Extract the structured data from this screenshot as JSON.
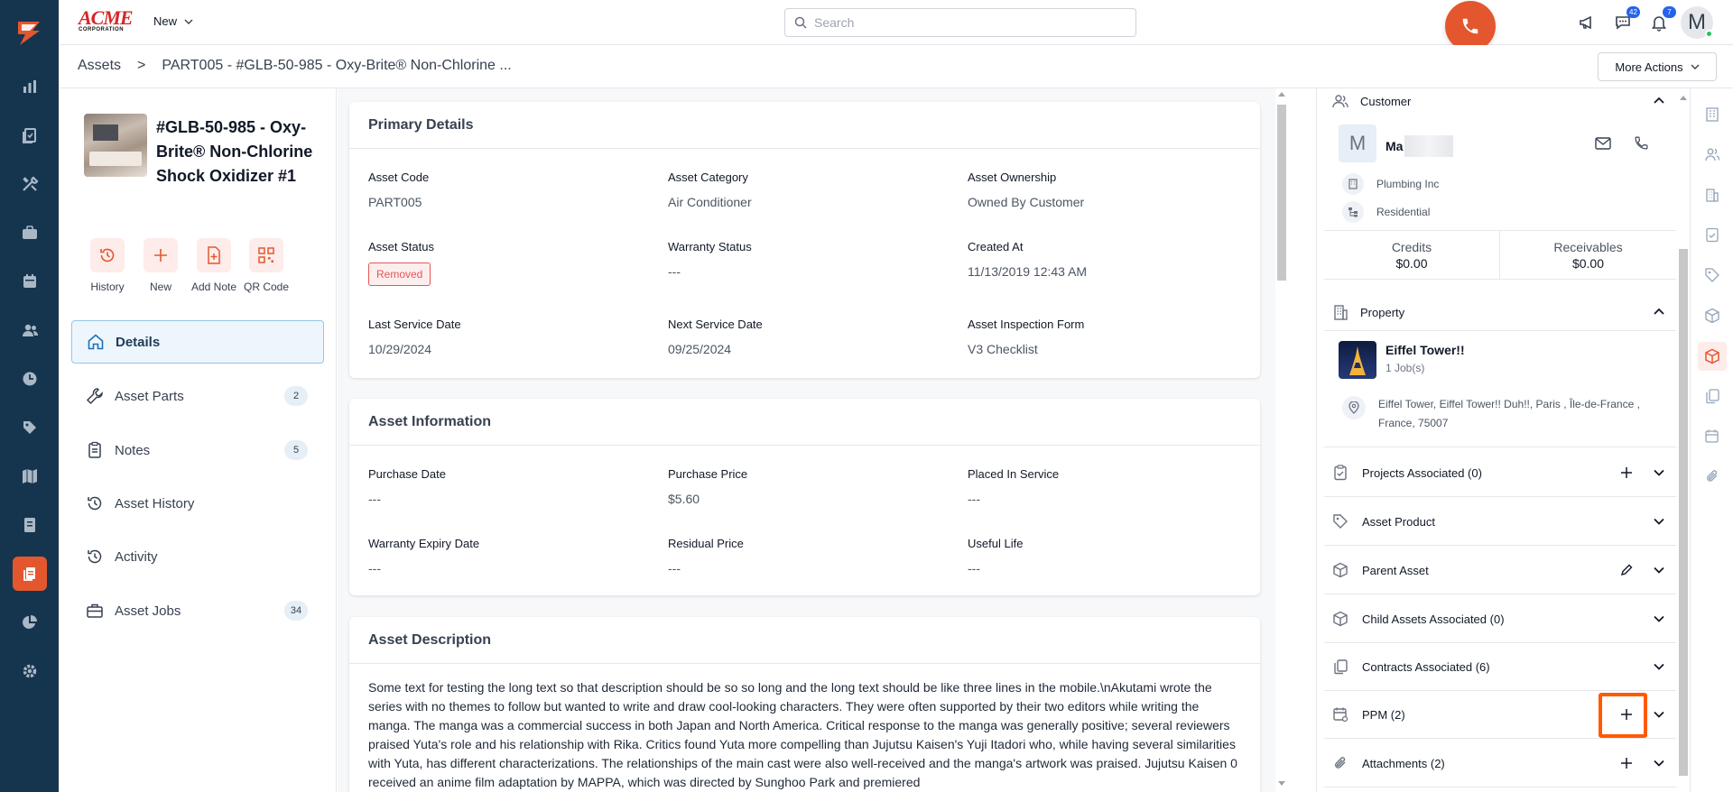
{
  "brand": {
    "name": "ACME",
    "subtitle": "CORPORATION"
  },
  "topbar": {
    "new_label": "New",
    "search_placeholder": "Search",
    "messages_badge": "42",
    "notifications_badge": "7",
    "avatar_initial": "M"
  },
  "breadcrumb": {
    "root": "Assets",
    "separator": ">",
    "current": "PART005 - #GLB-50-985 - Oxy-Brite® Non-Chlorine ..."
  },
  "more_actions_label": "More Actions",
  "asset": {
    "title": "#GLB-50-985 - Oxy-Brite® Non-Chlorine Shock Oxidizer #1"
  },
  "quick_actions": [
    {
      "label": "History",
      "icon": "history-icon"
    },
    {
      "label": "New",
      "icon": "plus-icon"
    },
    {
      "label": "Add Note",
      "icon": "add-note-icon"
    },
    {
      "label": "QR Code",
      "icon": "qr-code-icon"
    }
  ],
  "side_nav": [
    {
      "label": "Details",
      "icon": "home-icon",
      "count": ""
    },
    {
      "label": "Asset Parts",
      "icon": "wrench-icon",
      "count": "2"
    },
    {
      "label": "Notes",
      "icon": "clipboard-icon",
      "count": "5"
    },
    {
      "label": "Asset History",
      "icon": "history-icon",
      "count": ""
    },
    {
      "label": "Activity",
      "icon": "activity-icon",
      "count": ""
    },
    {
      "label": "Asset Jobs",
      "icon": "briefcase-icon",
      "count": "34"
    }
  ],
  "primary_details": {
    "title": "Primary Details",
    "asset_code_label": "Asset Code",
    "asset_code": "PART005",
    "asset_category_label": "Asset Category",
    "asset_category": "Air Conditioner",
    "asset_ownership_label": "Asset Ownership",
    "asset_ownership": "Owned By Customer",
    "asset_status_label": "Asset Status",
    "asset_status": "Removed",
    "warranty_status_label": "Warranty Status",
    "warranty_status": "---",
    "created_at_label": "Created At",
    "created_at": "11/13/2019 12:43 AM",
    "last_service_label": "Last Service Date",
    "last_service": "10/29/2024",
    "next_service_label": "Next Service Date",
    "next_service": "09/25/2024",
    "inspection_form_label": "Asset Inspection Form",
    "inspection_form": "V3 Checklist"
  },
  "asset_information": {
    "title": "Asset Information",
    "purchase_date_label": "Purchase Date",
    "purchase_date": "---",
    "purchase_price_label": "Purchase Price",
    "purchase_price": "$5.60",
    "placed_in_service_label": "Placed In Service",
    "placed_in_service": "---",
    "warranty_expiry_label": "Warranty Expiry Date",
    "warranty_expiry": "---",
    "residual_price_label": "Residual Price",
    "residual_price": "---",
    "useful_life_label": "Useful Life",
    "useful_life": "---"
  },
  "asset_description": {
    "title": "Asset Description",
    "text": "Some text for testing the long text so that description should be so so long and the long text should be like three lines in the mobile.\\nAkutami wrote the series with no themes to follow but wanted to write and draw cool-looking characters. They were often supported by their two editors while writing the manga. The manga was a commercial success in both Japan and North America. Critical response to the manga was generally positive; several reviewers praised Yuta's role and his relationship with Rika. Critics found Yuta more compelling than Jujutsu Kaisen's Yuji Itadori who, while having several similarities with Yuta, has different characterizations. The relationships of the main cast were also well-received and the manga's artwork was praised. Jujutsu Kaisen 0 received an anime film adaptation by MAPPA, which was directed by Sunghoo Park and premiered"
  },
  "customer": {
    "section_label": "Customer",
    "initial": "M",
    "name": "Ma",
    "company": "Plumbing Inc",
    "type": "Residential",
    "credits_label": "Credits",
    "credits": "$0.00",
    "receivables_label": "Receivables",
    "receivables": "$0.00"
  },
  "property": {
    "section_label": "Property",
    "name": "Eiffel Tower!!",
    "jobs": "1 Job(s)",
    "address": "Eiffel Tower, Eiffel Tower!! Duh!!, Paris , Île-de-France , France, 75007"
  },
  "right_sections": [
    {
      "label": "Projects Associated (0)",
      "icon": "clipboard-check-icon",
      "action": "plus-icon"
    },
    {
      "label": "Asset Product",
      "icon": "tag-icon",
      "action": ""
    },
    {
      "label": "Parent Asset",
      "icon": "cube-icon",
      "action": "pencil-icon"
    },
    {
      "label": "Child Assets Associated (0)",
      "icon": "cube-icon",
      "action": ""
    },
    {
      "label": "Contracts Associated (6)",
      "icon": "copy-icon",
      "action": ""
    },
    {
      "label": "PPM (2)",
      "icon": "calendar-gear-icon",
      "action": "plus-icon"
    },
    {
      "label": "Attachments (2)",
      "icon": "paperclip-icon",
      "action": "plus-icon"
    }
  ],
  "colors": {
    "rail_bg": "#15354f",
    "accent": "#e4572e",
    "highlight": "#ff5a00",
    "status_removed": "#e45656",
    "badge_blue": "#2563eb"
  }
}
